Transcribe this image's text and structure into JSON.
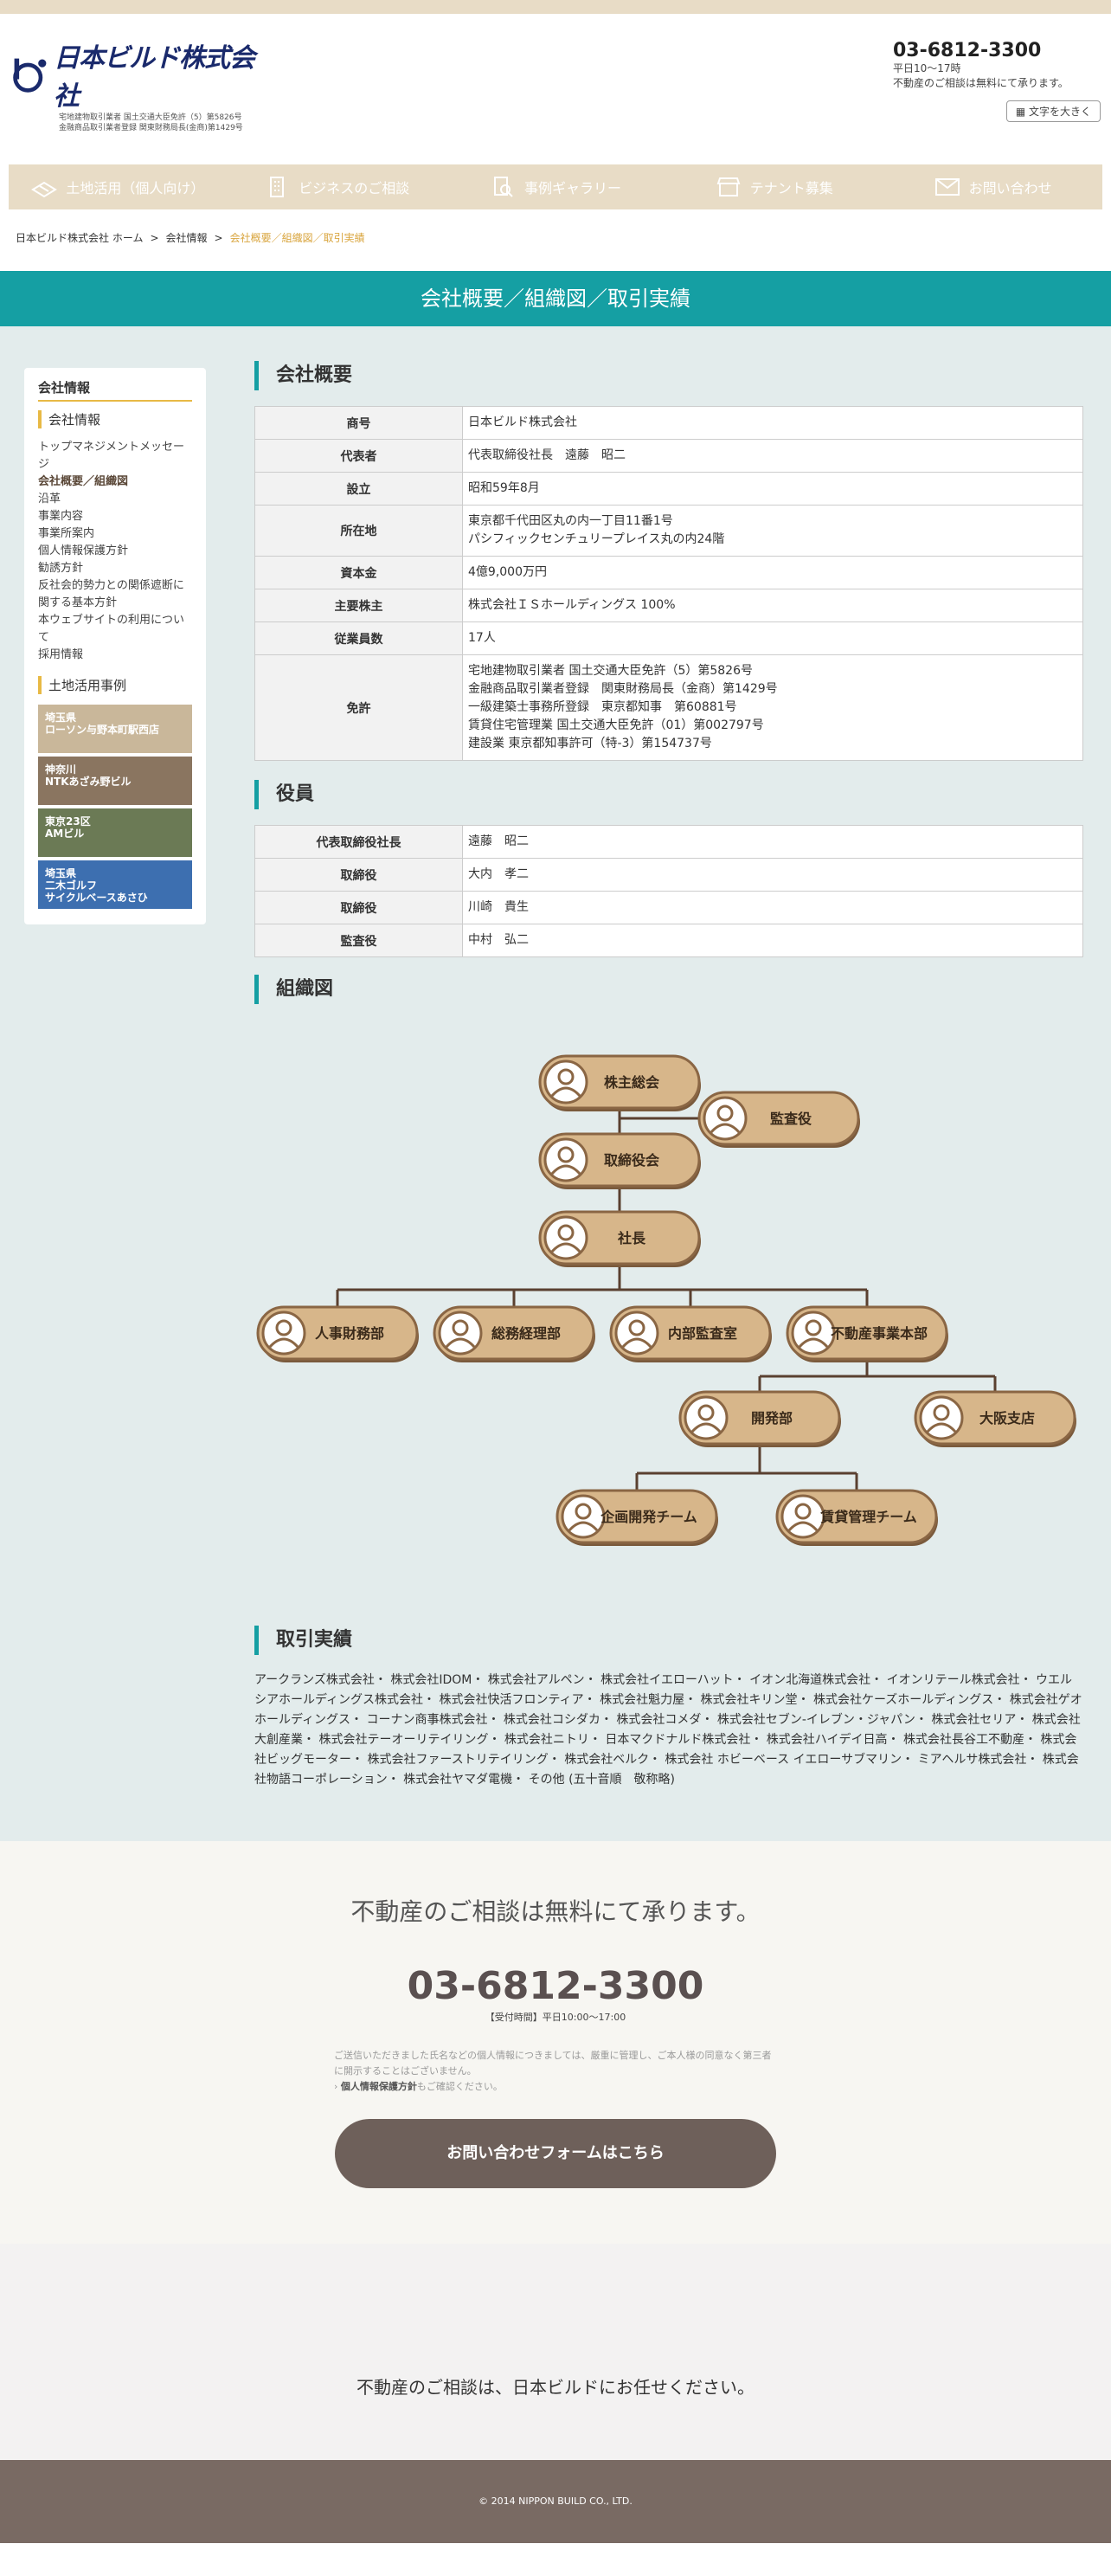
{
  "header": {
    "logo_text": "日本ビルド株式会社",
    "logo_sub1": "宅地建物取引業者 国土交通大臣免許（5）第5826号",
    "logo_sub2": "金融商品取引業者登録 関東財務局長(金商)第1429号",
    "phone": "03-6812-3300",
    "hours": "平日10〜17時",
    "note": "不動産のご相談は無料にて承ります。",
    "font_button": "文字を大きく"
  },
  "nav": [
    {
      "label": "土地活用（個人向け）",
      "icon": "land-icon"
    },
    {
      "label": "ビジネスのご相談",
      "icon": "building-icon"
    },
    {
      "label": "事例ギャラリー",
      "icon": "search-doc-icon"
    },
    {
      "label": "テナント募集",
      "icon": "shop-icon"
    },
    {
      "label": "お問い合わせ",
      "icon": "mail-icon"
    }
  ],
  "breadcrumb": {
    "home": "日本ビルド株式会社 ホーム",
    "parent": "会社情報",
    "current": "会社概要／組織図／取引実績",
    "sep": ">"
  },
  "banner_title": "会社概要／組織図／取引実績",
  "sidebar": {
    "heading": "会社情報",
    "section1": "会社情報",
    "links": [
      "トップマネジメントメッセージ",
      "会社概要／組織図",
      "沿革",
      "事業内容",
      "事業所案内",
      "個人情報保護方針",
      "勧誘方針",
      "反社会的勢力との関係遮断に関する基本方針",
      "本ウェブサイトの利用について",
      "採用情報"
    ],
    "section2": "土地活用事例",
    "cases": [
      {
        "label": "埼玉県\nローソン与野本町駅西店",
        "color": "#c9b79a"
      },
      {
        "label": "神奈川\nNTKあざみ野ビル",
        "color": "#8a7560"
      },
      {
        "label": "東京23区\nAMビル",
        "color": "#6b7a55"
      },
      {
        "label": "埼玉県\n二木ゴルフ\nサイクルベースあさひ",
        "color": "#3d6fb0"
      }
    ]
  },
  "overview": {
    "title": "会社概要",
    "rows": [
      {
        "k": "商号",
        "v": "日本ビルド株式会社"
      },
      {
        "k": "代表者",
        "v": "代表取締役社長　遠藤　昭二"
      },
      {
        "k": "設立",
        "v": "昭和59年8月"
      },
      {
        "k": "所在地",
        "v": "東京都千代田区丸の内一丁目11番1号\nパシフィックセンチュリープレイス丸の内24階"
      },
      {
        "k": "資本金",
        "v": "4億9,000万円"
      },
      {
        "k": "主要株主",
        "v": "株式会社ＩＳホールディングス 100%"
      },
      {
        "k": "従業員数",
        "v": "17人"
      },
      {
        "k": "免許",
        "v": "宅地建物取引業者 国土交通大臣免許（5）第5826号\n金融商品取引業者登録　関東財務局長（金商）第1429号\n一級建築士事務所登録　東京都知事　第60881号\n賃貸住宅管理業 国土交通大臣免許（01）第002797号\n建設業 東京都知事許可（特-3）第154737号"
      }
    ]
  },
  "officers": {
    "title": "役員",
    "rows": [
      {
        "k": "代表取締役社長",
        "v": "遠藤　昭二"
      },
      {
        "k": "取締役",
        "v": "大内　孝二"
      },
      {
        "k": "取締役",
        "v": "川崎　貴生"
      },
      {
        "k": "監査役",
        "v": "中村　弘二"
      }
    ]
  },
  "org": {
    "title": "組織図",
    "nodes": {
      "shareholders": "株主総会",
      "auditor": "監査役",
      "board": "取締役会",
      "president": "社長",
      "hr": "人事財務部",
      "general": "総務経理部",
      "audit": "内部監査室",
      "realestate": "不動産事業本部",
      "dev": "開発部",
      "osaka": "大阪支店",
      "planning": "企画開発チーム",
      "leasing": "賃貸管理チーム"
    }
  },
  "deals": {
    "title": "取引実績",
    "text": "アークランズ株式会社・ 株式会社IDOM・ 株式会社アルペン・ 株式会社イエローハット・ イオン北海道株式会社・ イオンリテール株式会社・ ウエルシアホールディングス株式会社・ 株式会社快活フロンティア・ 株式会社魁力屋・ 株式会社キリン堂・ 株式会社ケーズホールディングス・ 株式会社ゲオホールディングス・ コーナン商事株式会社・ 株式会社コシダカ・ 株式会社コメダ・ 株式会社セブン‐イレブン・ジャパン・ 株式会社セリア・ 株式会社大創産業・ 株式会社テーオーリテイリング・ 株式会社ニトリ・ 日本マクドナルド株式会社・ 株式会社ハイデイ日高・ 株式会社長谷工不動産・ 株式会社ビッグモーター・ 株式会社ファーストリテイリング・ 株式会社ベルク・ 株式会社 ホビーベース イエローサブマリン・ ミアヘルサ株式会社・ 株式会社物語コーポレーション・ 株式会社ヤマダ電機・ その他 (五十音順　敬称略)"
  },
  "cta": {
    "lead": "不動産のご相談は無料にて承ります。",
    "phone": "03-6812-3300",
    "hours": "【受付時間】平日10:00〜17:00",
    "note": "ご送信いただきました氏名などの個人情報につきましては、厳重に管理し、ご本人様の同意なく第三者に開示することはございません。",
    "policy_link": "個人情報保護方針",
    "policy_suffix": "もご確認ください。",
    "button": "お問い合わせフォームはこちら"
  },
  "footer": {
    "message": "不動産のご相談は、日本ビルドにお任せください。",
    "copyright": "© 2014 NIPPON BUILD CO., LTD."
  }
}
